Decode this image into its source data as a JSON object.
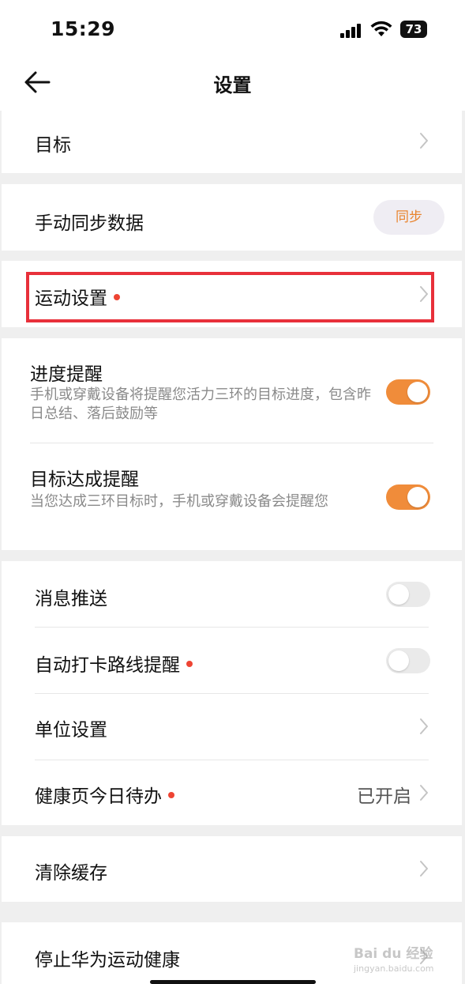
{
  "status_bar": {
    "time": "15:29",
    "battery": "73",
    "icons": [
      "signal-icon",
      "wifi-icon",
      "battery-icon"
    ]
  },
  "nav": {
    "title": "设置",
    "back_icon": "arrow-left-icon"
  },
  "groups": {
    "goal": {
      "label": "目标"
    },
    "sync": {
      "label": "手动同步数据",
      "button": "同步"
    },
    "sport_settings": {
      "label": "运动设置",
      "new_dot": true
    },
    "progress_reminder": {
      "title": "进度提醒",
      "desc": "手机或穿戴设备将提醒您活力三环的目标进度，包含昨日总结、落后鼓励等",
      "on": true
    },
    "goal_reached_reminder": {
      "title": "目标达成提醒",
      "desc": "当您达成三环目标时，手机或穿戴设备会提醒您",
      "on": true
    },
    "push_notifications": {
      "label": "消息推送",
      "on": false
    },
    "auto_checkin_route": {
      "label": "自动打卡路线提醒",
      "new_dot": true,
      "on": false
    },
    "unit_settings": {
      "label": "单位设置"
    },
    "health_todo": {
      "label": "健康页今日待办",
      "new_dot": true,
      "value": "已开启"
    },
    "clear_cache": {
      "label": "清除缓存"
    },
    "stop_service": {
      "label": "停止华为运动健康"
    }
  },
  "colors": {
    "accent": "#f08c3a",
    "sync_text": "#e8842e",
    "dot": "#ee4433",
    "highlight": "#e8303a"
  },
  "watermark": {
    "brand": "Bai du 经验",
    "url": "jingyan.baidu.com"
  }
}
